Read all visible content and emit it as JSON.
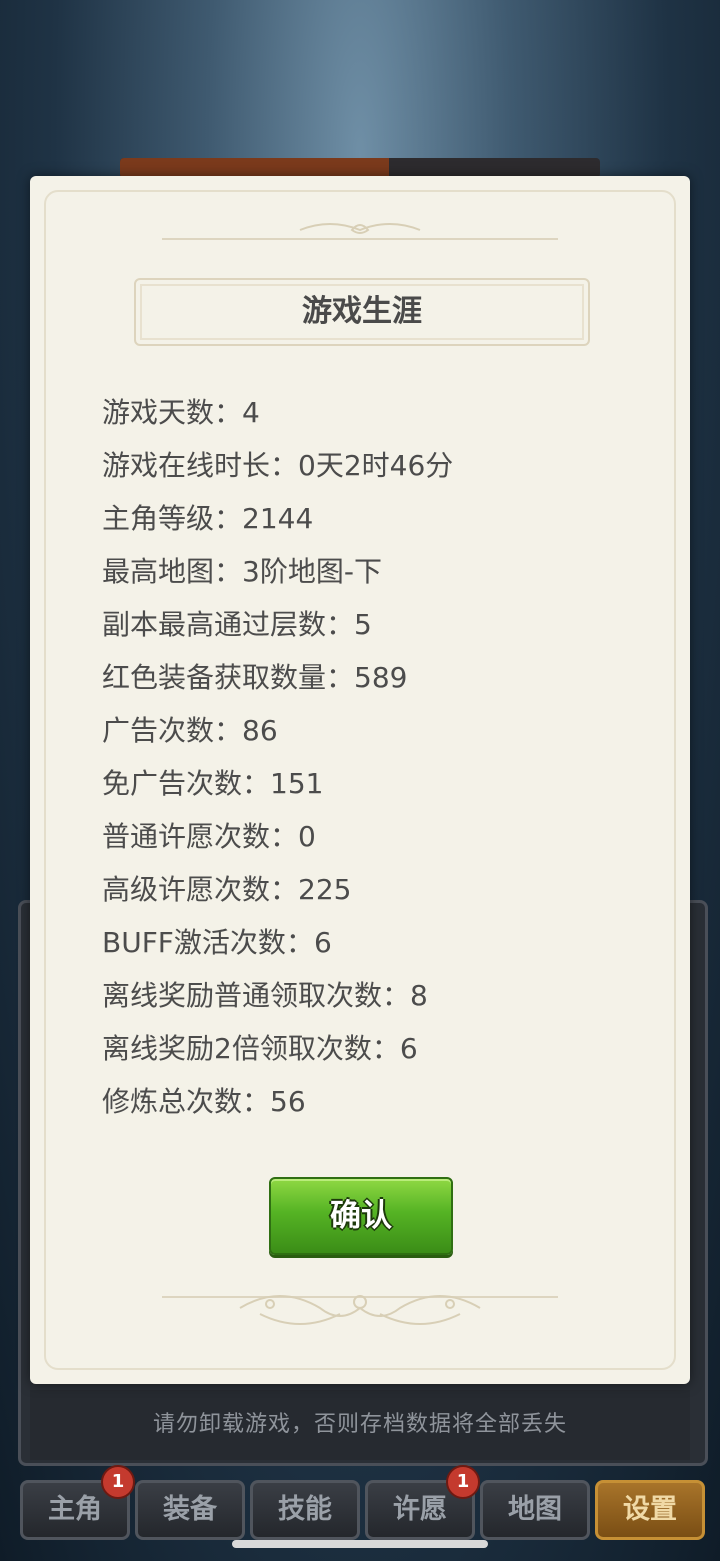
{
  "dialog": {
    "title": "游戏生涯",
    "stats": [
      {
        "label": "游戏天数",
        "value": "4"
      },
      {
        "label": "游戏在线时长",
        "value": "0天2时46分"
      },
      {
        "label": "主角等级",
        "value": "2144"
      },
      {
        "label": "最高地图",
        "value": "3阶地图-下"
      },
      {
        "label": "副本最高通过层数",
        "value": "5"
      },
      {
        "label": "红色装备获取数量",
        "value": "589"
      },
      {
        "label": "广告次数",
        "value": "86"
      },
      {
        "label": "免广告次数",
        "value": "151"
      },
      {
        "label": "普通许愿次数",
        "value": "0"
      },
      {
        "label": "高级许愿次数",
        "value": "225"
      },
      {
        "label": "BUFF激活次数",
        "value": "6"
      },
      {
        "label": "离线奖励普通领取次数",
        "value": "8"
      },
      {
        "label": "离线奖励2倍领取次数",
        "value": "6"
      },
      {
        "label": "修炼总次数",
        "value": "56"
      }
    ],
    "separator": "：",
    "confirm_label": "确认"
  },
  "notice": "请勿卸载游戏，否则存档数据将全部丢失",
  "nav": {
    "items": [
      {
        "label": "主角",
        "badge": "1",
        "active": false
      },
      {
        "label": "装备",
        "badge": "",
        "active": false
      },
      {
        "label": "技能",
        "badge": "",
        "active": false
      },
      {
        "label": "许愿",
        "badge": "1",
        "active": false
      },
      {
        "label": "地图",
        "badge": "",
        "active": false
      },
      {
        "label": "设置",
        "badge": "",
        "active": true
      }
    ]
  },
  "progress_fraction": 0.56,
  "colors": {
    "dialog_bg": "#f4f2e8",
    "confirm_green": "#55b324",
    "active_tab": "#a8742a",
    "badge_red": "#c43a2e"
  }
}
